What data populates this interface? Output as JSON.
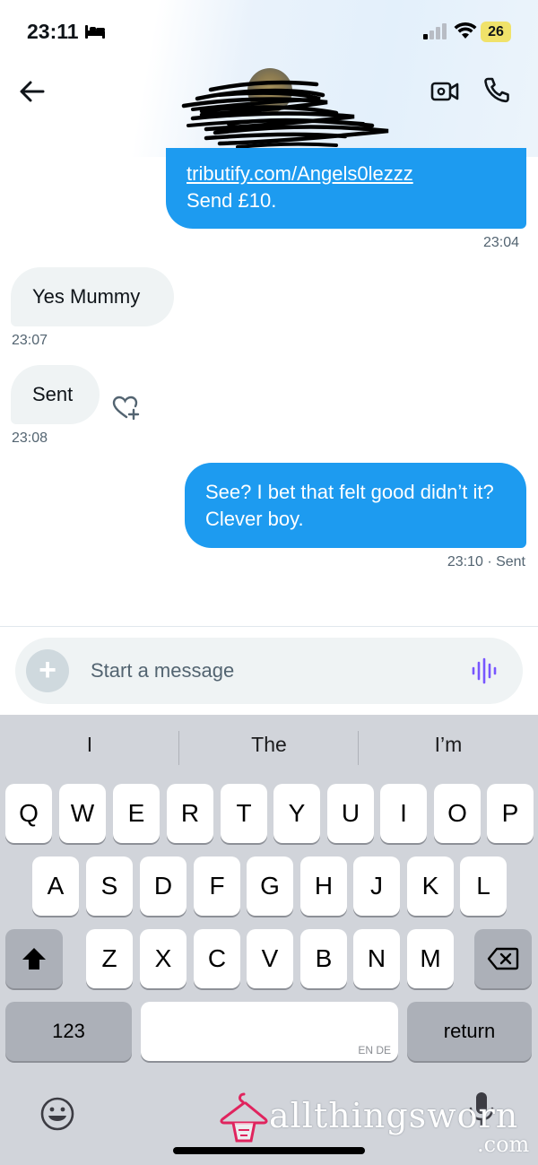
{
  "status_bar": {
    "time": "23:11",
    "battery": "26",
    "battery_color": "#f0e26a"
  },
  "header": {
    "back_icon": "arrow-left-icon",
    "video_icon": "video-call-icon",
    "phone_icon": "phone-icon"
  },
  "messages": [
    {
      "direction": "outgoing",
      "link": "tributify.com/Angels0lezzz",
      "text": "Send £10.",
      "time": "23:04"
    },
    {
      "direction": "incoming",
      "text": "Yes Mummy",
      "time": "23:07"
    },
    {
      "direction": "incoming",
      "text": "Sent",
      "time": "23:08"
    },
    {
      "direction": "outgoing",
      "text": "See? I bet that felt good didn’t it? Clever boy.",
      "time": "23:10",
      "status": "· Sent"
    }
  ],
  "composer": {
    "placeholder": "Start a message",
    "plus_label": "+"
  },
  "keyboard": {
    "suggestions": [
      "I",
      "The",
      "I’m"
    ],
    "row1": [
      "Q",
      "W",
      "E",
      "R",
      "T",
      "Y",
      "U",
      "I",
      "O",
      "P"
    ],
    "row2": [
      "A",
      "S",
      "D",
      "F",
      "G",
      "H",
      "J",
      "K",
      "L"
    ],
    "row3": [
      "Z",
      "X",
      "C",
      "V",
      "B",
      "N",
      "M"
    ],
    "numbers_label": "123",
    "return_label": "return",
    "space_hint": "EN DE"
  },
  "watermark": {
    "text": "allthingsworn",
    "sub": ".com"
  },
  "colors": {
    "outgoing_bubble": "#1d9bf0",
    "incoming_bubble": "#eff3f4",
    "voice_accent": "#7856ff"
  }
}
